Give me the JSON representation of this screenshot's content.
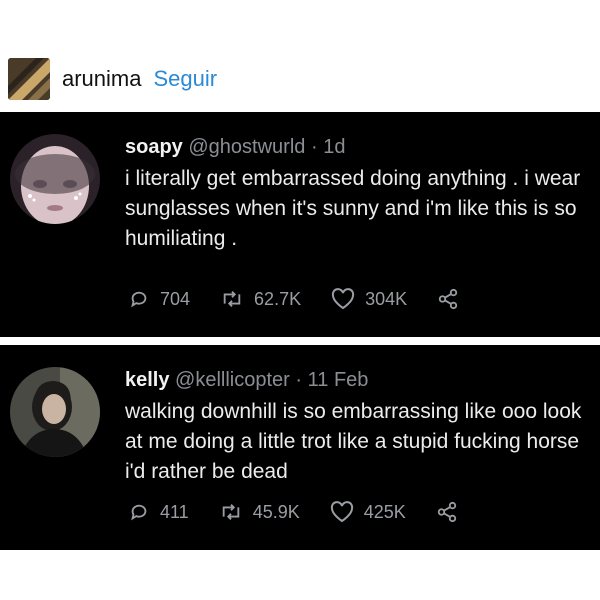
{
  "post": {
    "blog_name": "arunima",
    "follow_label": "Seguir"
  },
  "tweets": [
    {
      "name": "soapy",
      "handle": "@ghostwurld",
      "separator": "·",
      "time": "1d",
      "text": "i literally get embarrassed doing anything . i wear sunglasses when it's sunny and i'm like this is so humiliating .",
      "replies": "704",
      "retweets": "62.7K",
      "likes": "304K"
    },
    {
      "name": "kelly",
      "handle": "@kelllicopter",
      "separator": "·",
      "time": "11 Feb",
      "text": "walking downhill is so embarrassing like ooo look at me doing a little trot like a stupid fucking horse i'd rather be dead",
      "replies": "411",
      "retweets": "45.9K",
      "likes": "425K"
    }
  ],
  "colors": {
    "follow": "#2a8ad6",
    "tweet_bg": "#000000",
    "muted": "#8b8f94"
  }
}
